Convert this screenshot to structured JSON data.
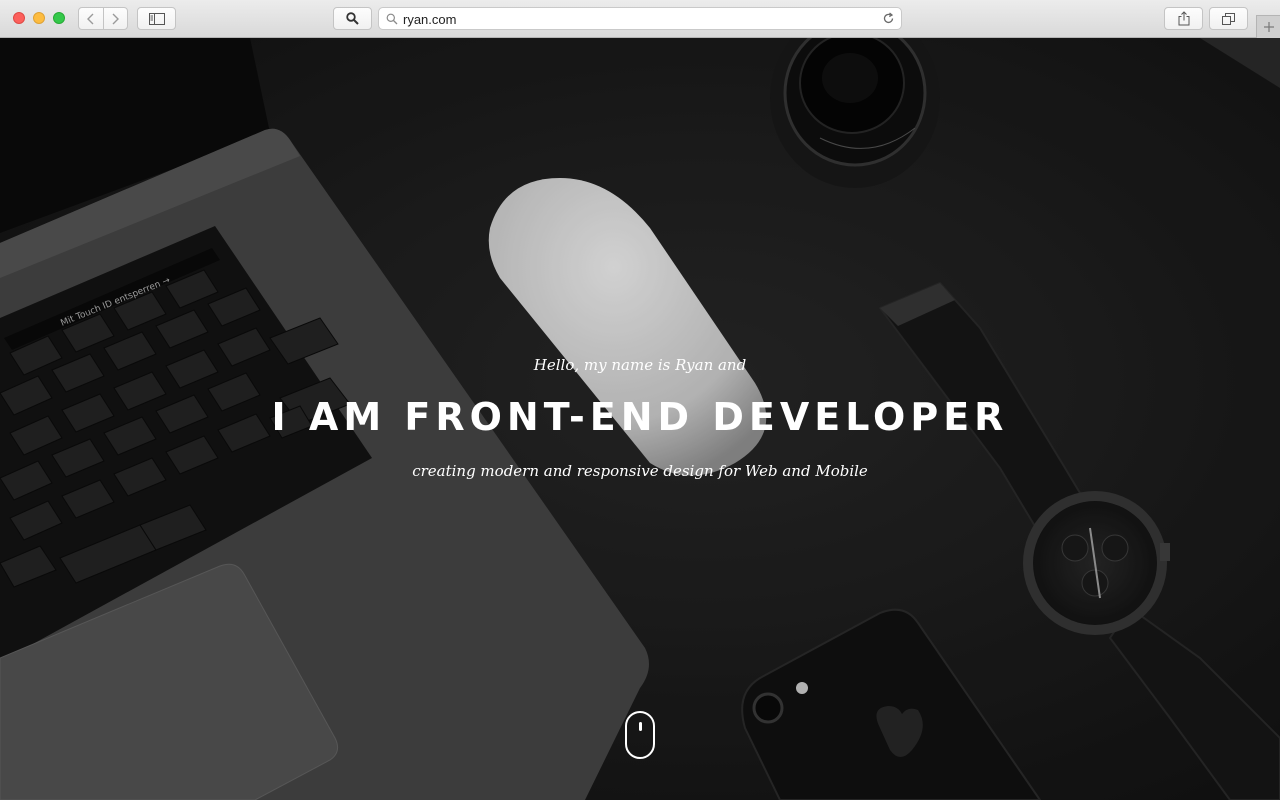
{
  "browser": {
    "url": "ryan.com",
    "icons": {
      "close": "close-icon",
      "minimize": "minimize-icon",
      "maximize": "maximize-icon",
      "back": "chevron-left-icon",
      "forward": "chevron-right-icon",
      "sidebar": "sidebar-icon",
      "search": "search-icon",
      "reload": "reload-icon",
      "share": "share-icon",
      "tabs": "tabs-icon",
      "new_tab": "plus-icon"
    },
    "colors": {
      "close": "#fc605c",
      "minimize": "#fdbc40",
      "maximize": "#34c84a"
    }
  },
  "hero": {
    "greeting": "Hello, my name is Ryan and",
    "headline": "I AM FRONT-END DEVELOPER",
    "tagline": "creating modern and responsive design for Web and Mobile",
    "keyboard_label": "Mit Touch ID entsperren →",
    "scroll_icon": "mouse-scroll-icon",
    "text_color": "#ffffff"
  }
}
